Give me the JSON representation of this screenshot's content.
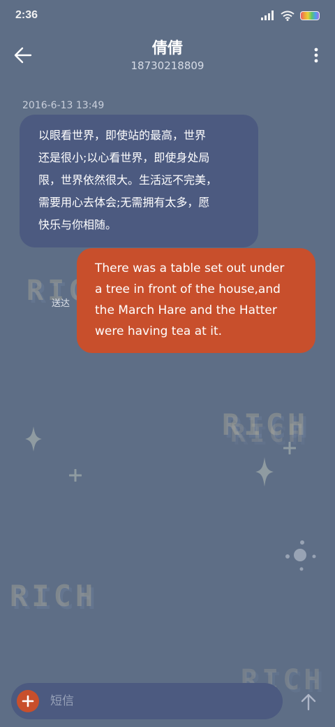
{
  "status_bar": {
    "time": "2:36",
    "icons": [
      "signal-icon",
      "wifi-icon",
      "battery-icon"
    ]
  },
  "header": {
    "contact_name": "倩倩",
    "phone_number": "18730218809",
    "back_icon": "arrow-left-icon",
    "more_icon": "more-vertical-icon"
  },
  "conversation": {
    "timestamp": "2016-6-13 13:49",
    "messages": [
      {
        "direction": "incoming",
        "lines": [
          "以眼看世界，即使站的最高，世界",
          "还是很小;以心看世界，即使身处局",
          "限，世界依然很大。生活远不完美，",
          "需要用心去体会;无需拥有太多，愿",
          "快乐与你相随。"
        ]
      },
      {
        "direction": "outgoing",
        "status": "送达",
        "lines": [
          "There was a table set out under",
          "a tree in front of the house,and",
          "the March Hare and the Hatter",
          "were having tea at it."
        ]
      }
    ]
  },
  "wallpaper": {
    "watermarks": [
      "RICH",
      "RICH",
      "RICH",
      "RICH",
      "RICH"
    ]
  },
  "composer": {
    "placeholder": "短信",
    "add_icon": "plus-icon",
    "send_icon": "arrow-up-icon"
  },
  "colors": {
    "background": "#5e6e86",
    "incoming_bubble": "#4c5a80",
    "outgoing_bubble": "#c84f2c",
    "accent": "#c84f2c"
  }
}
